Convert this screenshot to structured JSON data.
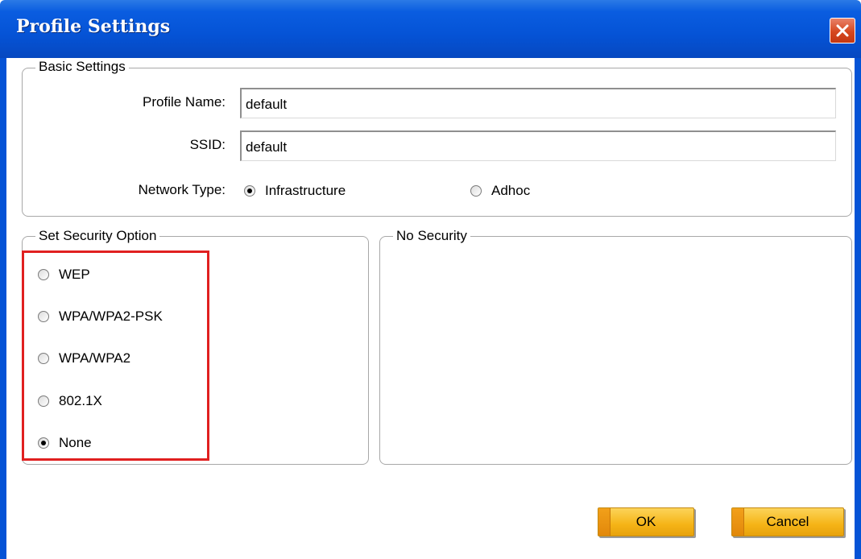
{
  "window": {
    "title": "Profile Settings",
    "close_icon": "close-icon",
    "title_bar_color": "#0553d6"
  },
  "basic_settings": {
    "legend": "Basic Settings",
    "profile_name_label": "Profile Name:",
    "profile_name_value": "default",
    "ssid_label": "SSID:",
    "ssid_value": "default",
    "network_type_label": "Network Type:",
    "network_types": [
      {
        "label": "Infrastructure",
        "selected": true
      },
      {
        "label": "Adhoc",
        "selected": false
      }
    ]
  },
  "security": {
    "legend": "Set Security Option",
    "options": [
      {
        "label": "WEP",
        "selected": false
      },
      {
        "label": "WPA/WPA2-PSK",
        "selected": false
      },
      {
        "label": "WPA/WPA2",
        "selected": false
      },
      {
        "label": "802.1X",
        "selected": false
      },
      {
        "label": "None",
        "selected": true
      }
    ],
    "highlight_color": "#e02020"
  },
  "details": {
    "legend": "No Security"
  },
  "buttons": {
    "ok_label": "OK",
    "cancel_label": "Cancel",
    "accent": "#f5b416"
  }
}
